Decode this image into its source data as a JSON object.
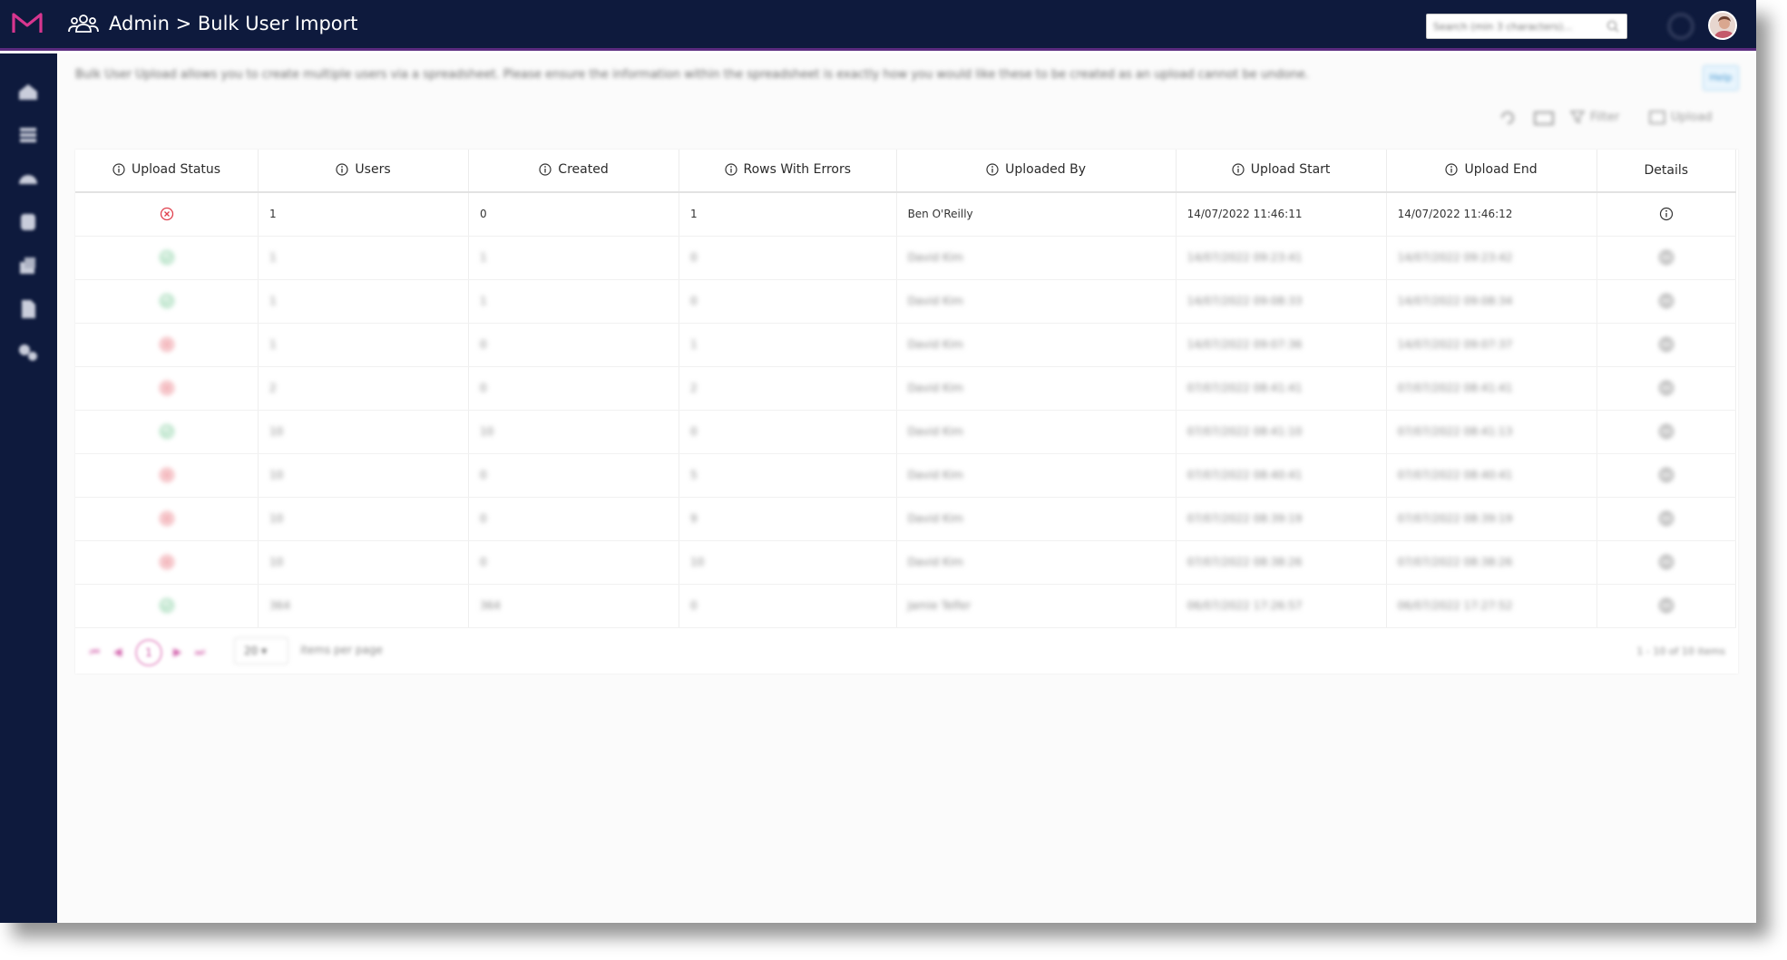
{
  "header": {
    "title": "Admin > Bulk User Import",
    "search_placeholder": "Search (min 3 characters)..."
  },
  "intro": {
    "text": "Bulk User Upload allows you to create multiple users via a spreadsheet. Please ensure the information within the spreadsheet is exactly how you would like these to be created as an upload cannot be undone.",
    "help_label": "Help"
  },
  "toolbar": {
    "filter_label": "Filter",
    "upload_label": "Upload"
  },
  "table": {
    "columns": [
      "Upload Status",
      "Users",
      "Created",
      "Rows With Errors",
      "Uploaded By",
      "Upload Start",
      "Upload End",
      "Details"
    ],
    "rows": [
      {
        "status": "error",
        "users": "1",
        "created": "0",
        "errors": "1",
        "by": "Ben O'Reilly",
        "start": "14/07/2022 11:46:11",
        "end": "14/07/2022 11:46:12"
      },
      {
        "status": "success",
        "users": "1",
        "created": "1",
        "errors": "0",
        "by": "David Kim",
        "start": "14/07/2022 09:23:41",
        "end": "14/07/2022 09:23:42"
      },
      {
        "status": "success",
        "users": "1",
        "created": "1",
        "errors": "0",
        "by": "David Kim",
        "start": "14/07/2022 09:08:33",
        "end": "14/07/2022 09:08:34"
      },
      {
        "status": "error",
        "users": "1",
        "created": "0",
        "errors": "1",
        "by": "David Kim",
        "start": "14/07/2022 09:07:36",
        "end": "14/07/2022 09:07:37"
      },
      {
        "status": "error",
        "users": "2",
        "created": "0",
        "errors": "2",
        "by": "David Kim",
        "start": "07/07/2022 08:41:41",
        "end": "07/07/2022 08:41:41"
      },
      {
        "status": "success",
        "users": "10",
        "created": "10",
        "errors": "0",
        "by": "David Kim",
        "start": "07/07/2022 08:41:10",
        "end": "07/07/2022 08:41:13"
      },
      {
        "status": "error",
        "users": "10",
        "created": "0",
        "errors": "5",
        "by": "David Kim",
        "start": "07/07/2022 08:40:41",
        "end": "07/07/2022 08:40:41"
      },
      {
        "status": "error",
        "users": "10",
        "created": "0",
        "errors": "9",
        "by": "David Kim",
        "start": "07/07/2022 08:39:19",
        "end": "07/07/2022 08:39:19"
      },
      {
        "status": "error",
        "users": "10",
        "created": "0",
        "errors": "10",
        "by": "David Kim",
        "start": "07/07/2022 08:38:26",
        "end": "07/07/2022 08:38:26"
      },
      {
        "status": "success",
        "users": "364",
        "created": "364",
        "errors": "0",
        "by": "Jamie Telfer",
        "start": "06/07/2022 17:26:57",
        "end": "06/07/2022 17:27:52"
      }
    ]
  },
  "pager": {
    "current_page": "1",
    "page_size": "20",
    "per_page_label": "items per page",
    "range_text": "1 - 10 of 10 items"
  },
  "colors": {
    "header_bg": "#0e1a3d",
    "accent": "#d05aa8",
    "error": "#e0414e",
    "success": "#3fb36a"
  }
}
